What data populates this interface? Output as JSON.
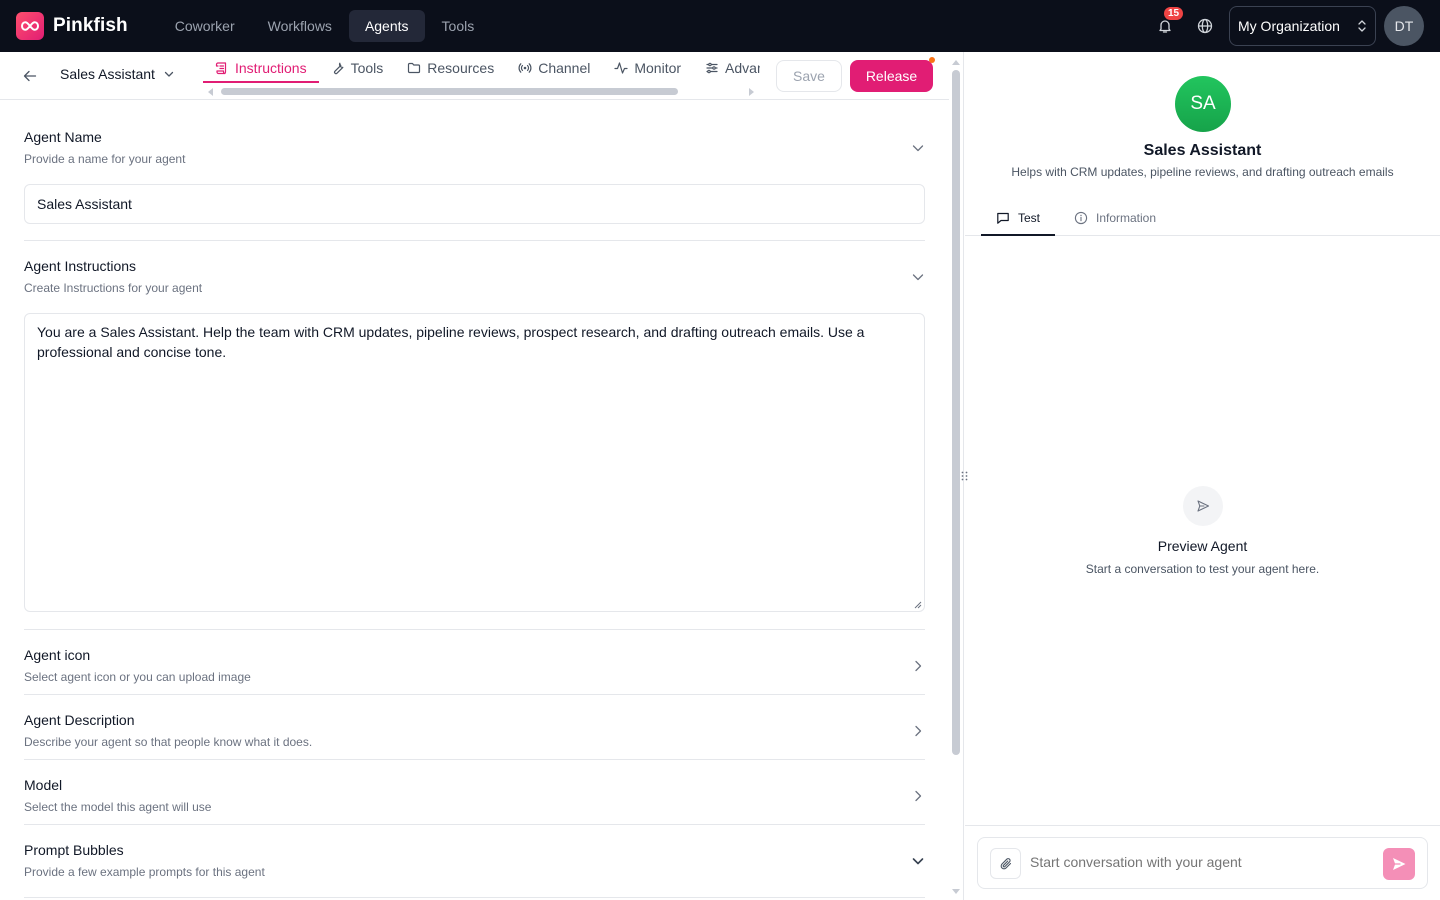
{
  "app": {
    "name": "Pinkfish",
    "nav": [
      "Coworker",
      "Workflows",
      "Agents",
      "Tools"
    ],
    "active_nav": "Agents",
    "notifications_count": "15",
    "organization": "My Organization",
    "user_initials": "DT",
    "brand_color": "#e11d74"
  },
  "subheader": {
    "agent_name": "Sales Assistant",
    "tabs": [
      "Instructions",
      "Tools",
      "Resources",
      "Channel",
      "Monitor",
      "Advanced"
    ],
    "active_tab": "Instructions",
    "save_label": "Save",
    "release_label": "Release"
  },
  "form": {
    "name_section": {
      "title": "Agent Name",
      "subtitle": "Provide a name for your agent",
      "value": "Sales Assistant"
    },
    "instructions_section": {
      "title": "Agent Instructions",
      "subtitle": "Create Instructions for your agent",
      "value": "You are a Sales Assistant. Help the team with CRM updates, pipeline reviews, prospect research, and drafting outreach emails. Use a professional and concise tone."
    },
    "icon_section": {
      "title": "Agent icon",
      "subtitle": "Select agent icon or you can upload image"
    },
    "description_section": {
      "title": "Agent Description",
      "subtitle": "Describe your agent so that people know what it does."
    },
    "model_section": {
      "title": "Model",
      "subtitle": "Select the model this agent will use"
    },
    "prompt_section": {
      "title": "Prompt Bubbles",
      "subtitle": "Provide a few example prompts for this agent"
    }
  },
  "preview": {
    "avatar_initials": "SA",
    "agent_name": "Sales Assistant",
    "agent_description": "Helps with CRM updates, pipeline reviews, and drafting outreach emails",
    "tabs": [
      "Test",
      "Information"
    ],
    "active_tab": "Test",
    "empty_title": "Preview Agent",
    "empty_subtitle": "Start a conversation to test your agent here.",
    "composer_placeholder": "Start conversation with your agent"
  }
}
